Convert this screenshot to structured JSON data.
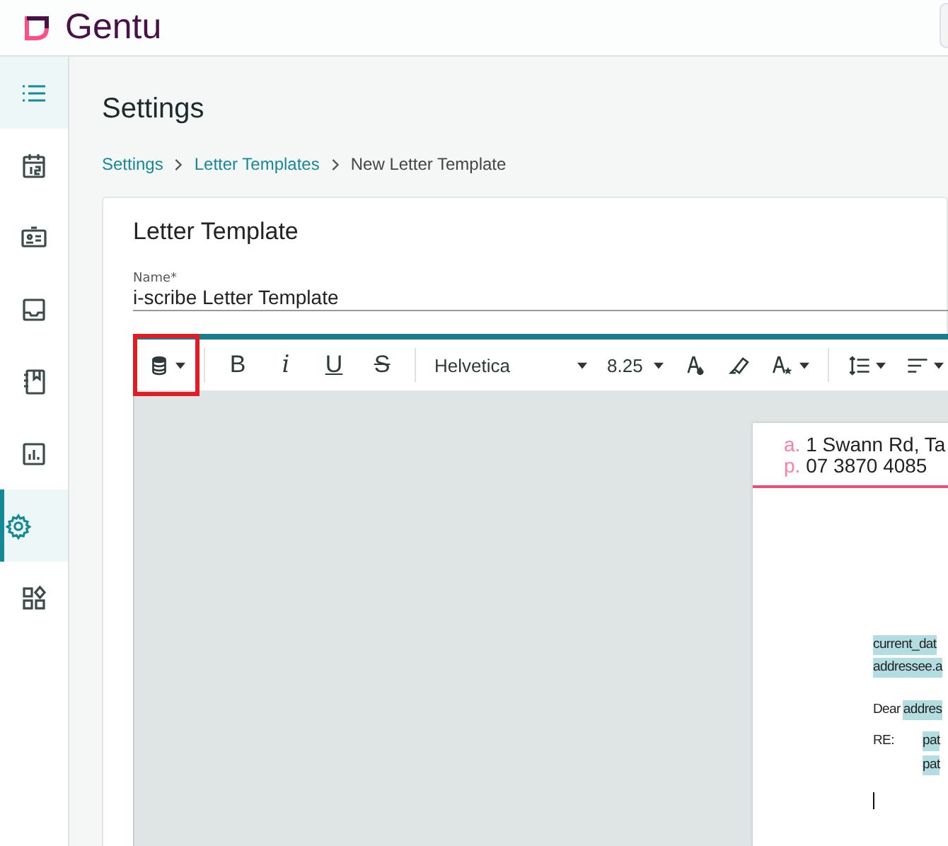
{
  "brand": {
    "name": "Gentu"
  },
  "sidebar": {
    "items": [
      {
        "selected": false
      },
      {
        "selected": false
      },
      {
        "selected": false
      },
      {
        "selected": false
      },
      {
        "selected": false
      },
      {
        "selected": true
      },
      {
        "selected": false
      }
    ]
  },
  "page": {
    "title": "Settings",
    "breadcrumbs": [
      "Settings",
      "Letter Templates",
      "New Letter Template"
    ]
  },
  "card": {
    "title": "Letter Template",
    "name_field": {
      "label": "Name*",
      "value": "i-scribe Letter Template"
    }
  },
  "toolbar": {
    "formats": [
      "B",
      "i",
      "U",
      "S"
    ],
    "font": "Helvetica",
    "size": "8.25"
  },
  "letter": {
    "header": [
      {
        "prefix": "a.",
        "text": "1 Swann Rd, Ta"
      },
      {
        "prefix": "p.",
        "text": "07 3870 4085"
      }
    ],
    "lines": [
      {
        "fields": [
          "current_dat"
        ]
      },
      {
        "fields": [
          "addressee.a"
        ]
      },
      {
        "label": "Dear",
        "fields": [
          "addres"
        ]
      },
      {
        "label": "RE:",
        "fields": [
          "pat",
          "pat"
        ]
      }
    ]
  }
}
